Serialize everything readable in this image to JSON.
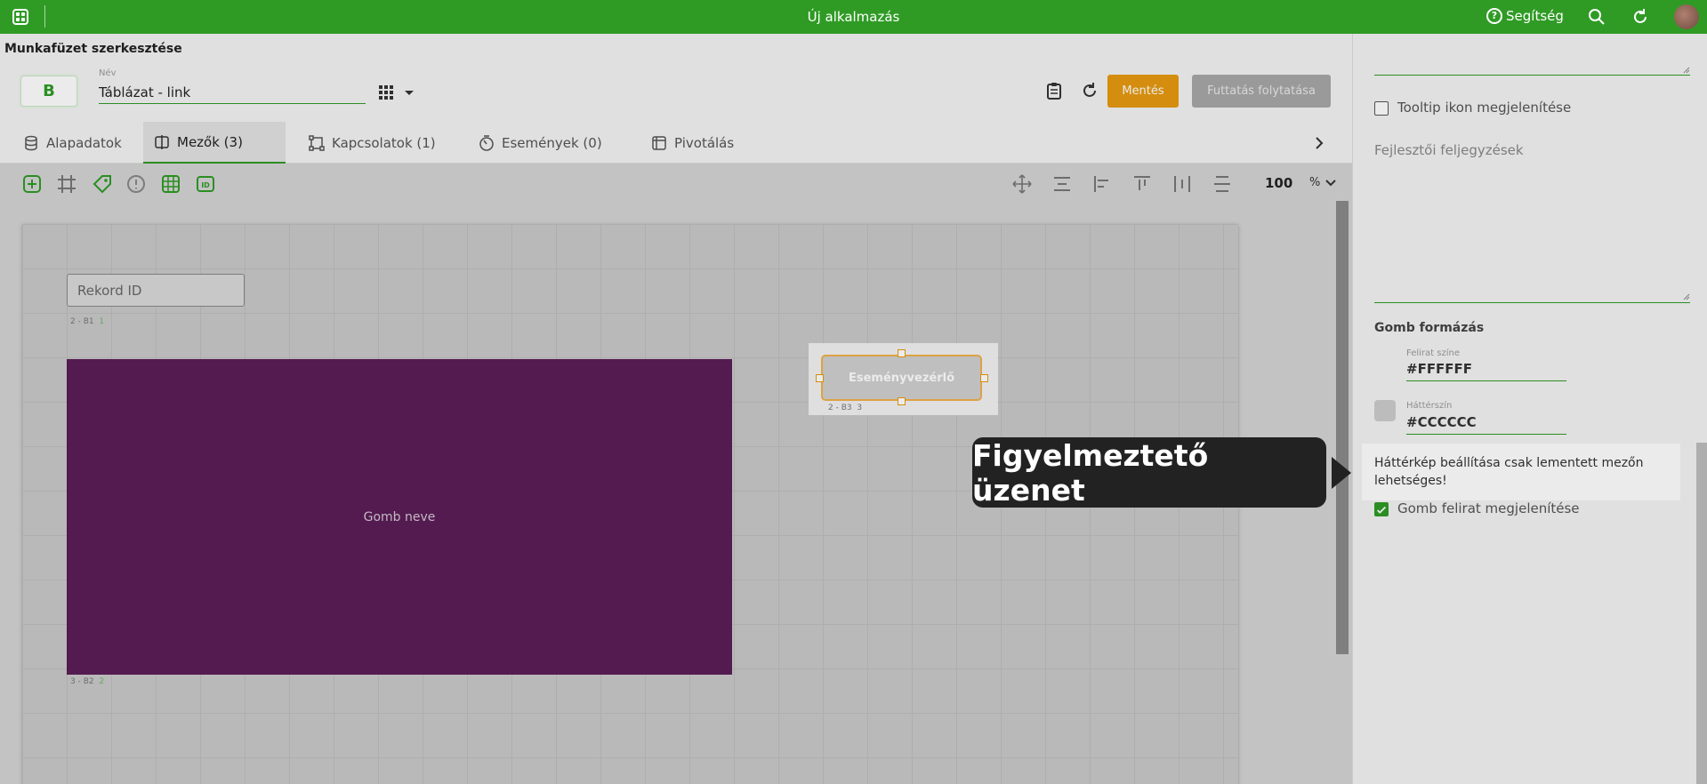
{
  "topbar": {
    "app_title": "Új alkalmazás",
    "help_label": "Segítség"
  },
  "header": {
    "page_title": "Munkafüzet szerkesztése",
    "logo_letter": "B",
    "name_label": "Név",
    "name_value": "Táblázat - link",
    "save_label": "Mentés",
    "run_label": "Futtatás folytatása"
  },
  "tabs": [
    {
      "label": "Alapadatok",
      "icon": "database-icon"
    },
    {
      "label": "Mezők (3)",
      "icon": "fields-icon",
      "active": true
    },
    {
      "label": "Kapcsolatok (1)",
      "icon": "relations-icon"
    },
    {
      "label": "Események (0)",
      "icon": "events-icon"
    },
    {
      "label": "Pivotálás",
      "icon": "pivot-icon"
    }
  ],
  "zoom": {
    "value": "100",
    "unit": "%"
  },
  "canvas": {
    "record_field": "Rekord ID",
    "record_field_tag": "2 - B1",
    "record_field_tag_num": "1",
    "big_button_label": "Gomb neve",
    "big_button_tag": "3 - B2",
    "big_button_tag_num": "2",
    "big_button_color": "#5b1e57",
    "event_button_label": "Eseményvezérlő",
    "event_button_tag": "2 - B3",
    "event_button_tag_num": "3"
  },
  "panel": {
    "tooltip_checkbox_label": "Tooltip ikon megjelenítése",
    "dev_notes_placeholder": "Fejlesztői feljegyzések",
    "section_title": "Gomb formázás",
    "text_color_label": "Felirat színe",
    "text_color_value": "#FFFFFF",
    "bg_color_label": "Háttérszín",
    "bg_color_value": "#CCCCCC",
    "warning_text": "Háttérkép beállítása csak lementett mezőn lehetséges!",
    "show_label_checkbox": "Gomb felirat megjelenítése"
  },
  "callout": {
    "text": "Figyelmeztető üzenet"
  },
  "colors": {
    "brand": "#2f9b25",
    "save": "#e69a10",
    "run_disabled": "#a8a8a8"
  }
}
